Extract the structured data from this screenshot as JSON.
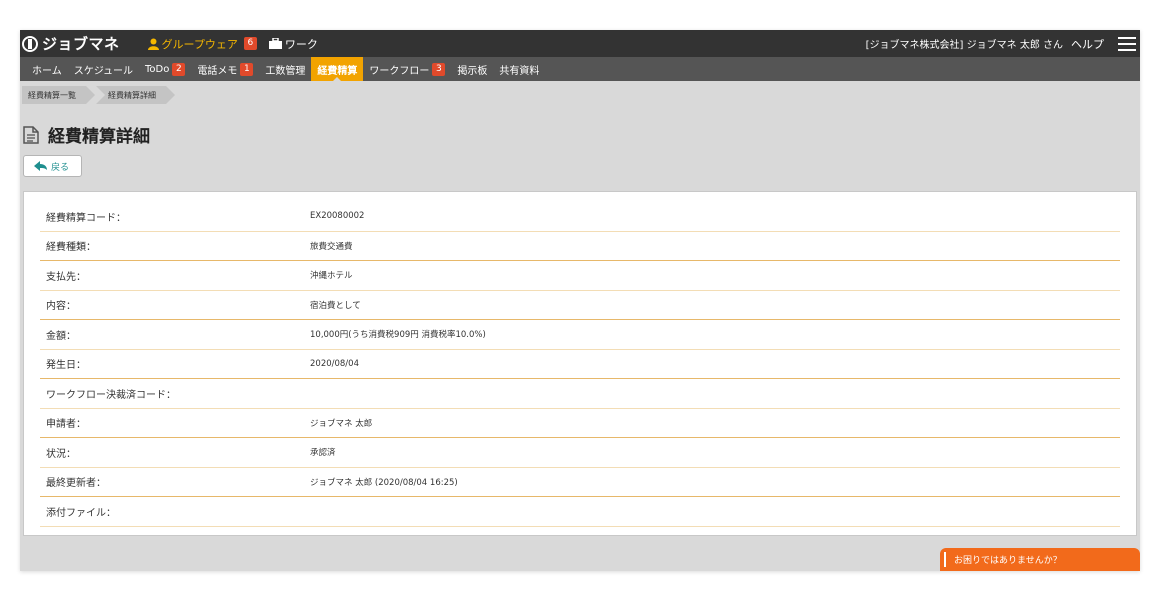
{
  "header": {
    "logo_text": "ジョブマネ",
    "groupware_label": "グループウェア",
    "groupware_count": "6",
    "work_label": "ワーク",
    "user_text": "[ジョブマネ株式会社] ジョブマネ 太郎 さん",
    "help_label": "ヘルプ"
  },
  "nav": {
    "items": [
      {
        "label": "ホーム"
      },
      {
        "label": "スケジュール"
      },
      {
        "label": "ToDo",
        "badge": "2"
      },
      {
        "label": "電話メモ",
        "badge": "1"
      },
      {
        "label": "工数管理"
      },
      {
        "label": "経費精算"
      },
      {
        "label": "ワークフロー",
        "badge": "3"
      },
      {
        "label": "掲示板"
      },
      {
        "label": "共有資料"
      }
    ],
    "active_index": 5
  },
  "breadcrumb": [
    "経費精算一覧",
    "経費精算詳細"
  ],
  "page_title": "経費精算詳細",
  "back_label": "戻る",
  "details": [
    {
      "label": "経費精算コード：",
      "value": "EX20080002"
    },
    {
      "label": "経費種類：",
      "value": "旅費交通費"
    },
    {
      "label": "支払先：",
      "value": "沖縄ホテル"
    },
    {
      "label": "内容：",
      "value": "宿泊費として"
    },
    {
      "label": "金額：",
      "value": "10,000円(うち消費税909円 消費税率10.0%)"
    },
    {
      "label": "発生日：",
      "value": "2020/08/04"
    },
    {
      "label": "ワークフロー決裁済コード：",
      "value": ""
    },
    {
      "label": "申請者：",
      "value": "ジョブマネ 太郎"
    },
    {
      "label": "状況：",
      "value": "承認済"
    },
    {
      "label": "最終更新者：",
      "value": "ジョブマネ 太郎 (2020/08/04 16:25)"
    },
    {
      "label": "添付ファイル：",
      "value": ""
    }
  ],
  "help_tab_label": "お困りではありませんか？",
  "colors": {
    "topbar": "#333333",
    "navbar": "#555555",
    "accent": "#f2a300",
    "badge": "#e14a2b",
    "help_tab": "#f26a1b"
  }
}
